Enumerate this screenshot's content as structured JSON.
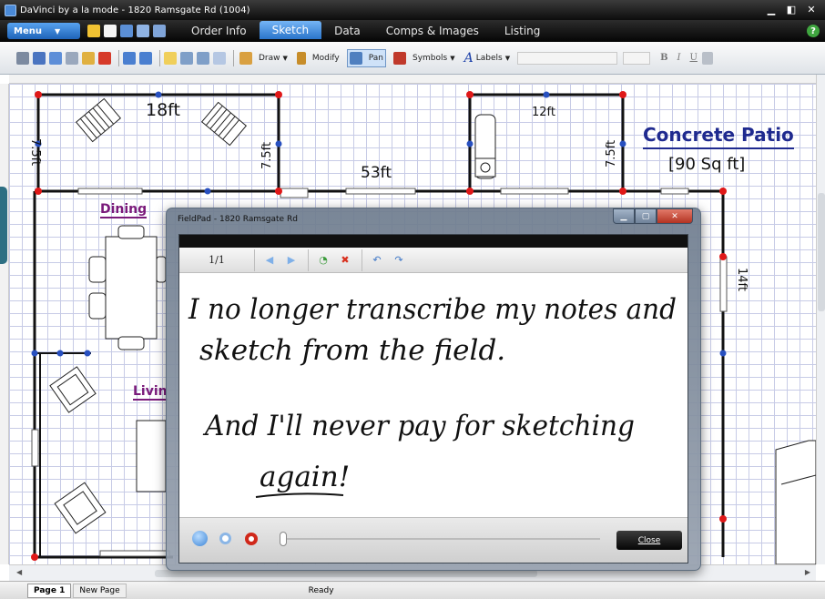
{
  "window": {
    "title": "DaVinci by a la mode - 1820 Ramsgate Rd (1004)",
    "controls": {
      "minimize": "▁",
      "maximize": "◧",
      "close": "✕"
    }
  },
  "menubar": {
    "menu_label": "Menu",
    "tabs": [
      {
        "label": "Order Info",
        "active": false
      },
      {
        "label": "Sketch",
        "active": true
      },
      {
        "label": "Data",
        "active": false
      },
      {
        "label": "Comps & Images",
        "active": false
      },
      {
        "label": "Listing",
        "active": false
      }
    ],
    "help_glyph": "?"
  },
  "toolbar": {
    "draw_label": "Draw",
    "modify_label": "Modify",
    "pan_label": "Pan",
    "symbols_label": "Symbols",
    "labels_label": "Labels",
    "format_bold": "B",
    "format_italic": "I",
    "format_underline": "U"
  },
  "sketch": {
    "dim_18ft": "18ft",
    "dim_7_5_left": "7.5ft",
    "dim_7_5_mid": "7.5ft",
    "dim_53ft": "53ft",
    "dim_12ft": "12ft",
    "dim_7_5_right": "7.5ft",
    "dim_14ft": "14ft",
    "patio_title": "Concrete Patio",
    "patio_area": "[90 Sq ft]",
    "room_dining": "Dining",
    "room_living": "Livin"
  },
  "fieldpad": {
    "title": "FieldPad - 1820 Ramsgate Rd",
    "page_indicator": "1/1",
    "handwriting": {
      "line1": "I no longer transcribe my notes and",
      "line2": "sketch from the field.",
      "line3": "And I'll never pay for sketching",
      "line4": "again!"
    },
    "close_label": "Close"
  },
  "status": {
    "page1": "Page 1",
    "new_page": "New Page",
    "ready": "Ready"
  },
  "colors": {
    "accent_blue": "#2a74cb",
    "patio_text": "#1f2a8f",
    "room_label": "#7a1a7a",
    "corner_red": "#e01818",
    "node_blue": "#2850c0"
  }
}
